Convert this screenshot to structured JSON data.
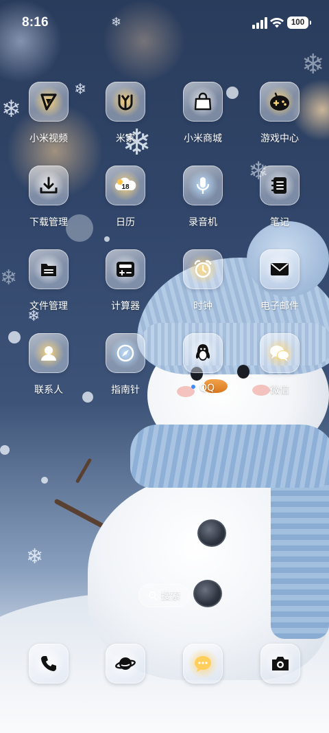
{
  "status_bar": {
    "time": "8:16",
    "battery": "100"
  },
  "apps": [
    {
      "label": "小米视频",
      "icon": "video-play-icon"
    },
    {
      "label": "米家",
      "icon": "mijia-icon"
    },
    {
      "label": "小米商城",
      "icon": "shopping-bag-icon"
    },
    {
      "label": "游戏中心",
      "icon": "game-controller-icon"
    },
    {
      "label": "下载管理",
      "icon": "download-icon"
    },
    {
      "label": "日历",
      "icon": "calendar-icon",
      "badge_text": "18"
    },
    {
      "label": "录音机",
      "icon": "microphone-icon"
    },
    {
      "label": "笔记",
      "icon": "notes-icon"
    },
    {
      "label": "文件管理",
      "icon": "folder-icon"
    },
    {
      "label": "计算器",
      "icon": "calculator-icon"
    },
    {
      "label": "时钟",
      "icon": "alarm-clock-icon"
    },
    {
      "label": "电子邮件",
      "icon": "mail-icon"
    },
    {
      "label": "联系人",
      "icon": "contact-icon"
    },
    {
      "label": "指南针",
      "icon": "compass-icon"
    },
    {
      "label": "QQ",
      "icon": "qq-penguin-icon",
      "new_indicator": true
    },
    {
      "label": "微信",
      "icon": "wechat-icon"
    }
  ],
  "search": {
    "label": "搜索",
    "icon": "search-icon"
  },
  "dock": [
    {
      "icon": "phone-icon"
    },
    {
      "icon": "browser-planet-icon"
    },
    {
      "icon": "message-icon"
    },
    {
      "icon": "camera-icon"
    }
  ],
  "colors": {
    "new_indicator": "#3d8bff",
    "icon_glyph": "#111111",
    "warm_glow": "#ffd678",
    "cool_glow": "#bee1ff"
  }
}
